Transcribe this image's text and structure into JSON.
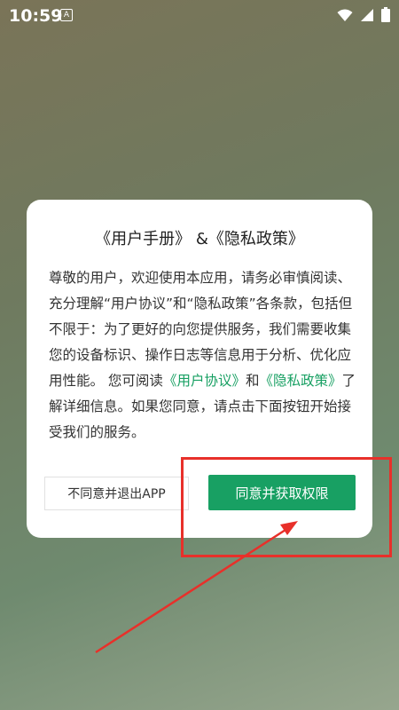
{
  "status_bar": {
    "time": "10:59",
    "notification_letter": "A",
    "icons": [
      "wifi-icon",
      "signal-icon",
      "battery-icon"
    ]
  },
  "dialog": {
    "title": "《用户手册》 &《隐私政策》",
    "paragraph_part1": "尊敬的用户，欢迎使用本应用，请务必审慎阅读、充分理解“用户协议”和“隐私政策”各条款，包括但不限于：为了更好的向您提供服务，我们需要收集您的设备标识、操作日志等信息用于分析、优化应用性能。 您可阅读",
    "link_user_agreement": "《用户协议》",
    "and_word": "和",
    "link_privacy_policy": "《隐私政策》",
    "paragraph_part2": "了解详细信息。如果您同意，请点击下面按钮开始接受我们的服务。",
    "decline_button": "不同意并退出APP",
    "accept_button": "同意并获取权限"
  },
  "colors": {
    "accent": "#18a063",
    "annotation": "#e8302a"
  }
}
